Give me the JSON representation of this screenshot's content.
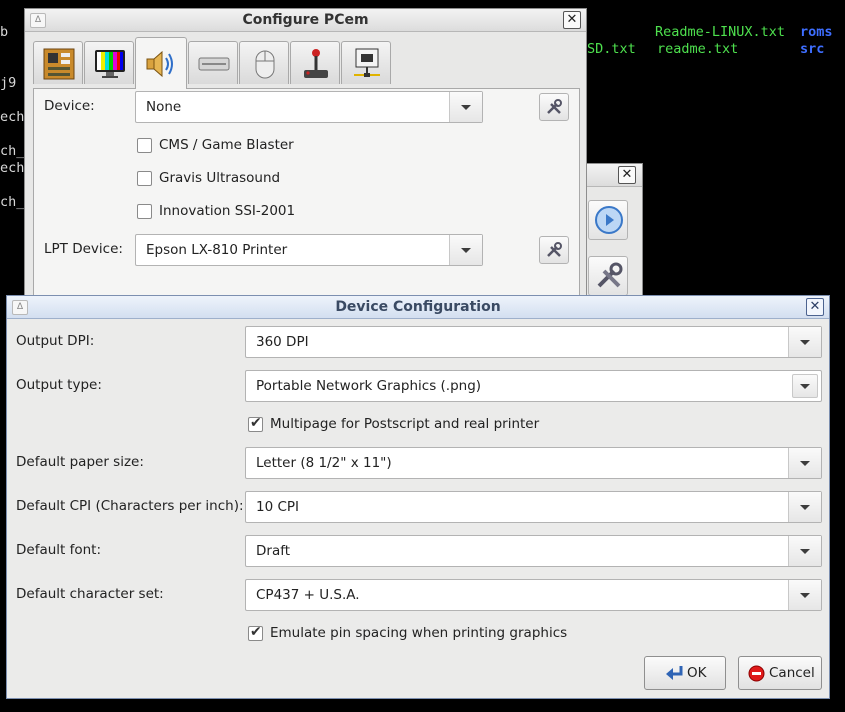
{
  "terminal": {
    "line1_green_left": "SD.txt",
    "readme_linux": "Readme-LINUX.txt",
    "readme_txt": "readme.txt",
    "roms": "roms",
    "src": "src",
    "b": "b",
    "j9": "j9",
    "ech1": "ech",
    "ch": "ch_",
    "ech2": "ech",
    "ch2": "ch_"
  },
  "configure_window": {
    "title": "Configure PCem",
    "tabs": [
      "motherboard-icon",
      "display-icon",
      "sound-icon",
      "drive-icon",
      "mouse-icon",
      "joystick-icon",
      "network-icon"
    ],
    "device_label": "Device:",
    "device_value": "None",
    "checkboxes": [
      {
        "label": "CMS / Game Blaster",
        "checked": false
      },
      {
        "label": "Gravis Ultrasound",
        "checked": false
      },
      {
        "label": "Innovation SSI-2001",
        "checked": false
      }
    ],
    "lpt_label": "LPT Device:",
    "lpt_value": "Epson LX-810 Printer"
  },
  "device_config": {
    "title": "Device Configuration",
    "fields": [
      {
        "label": "Output DPI:",
        "value": "360 DPI"
      },
      {
        "label": "Output type:",
        "value": "Portable Network Graphics (.png)"
      },
      {
        "label": "Default paper size:",
        "value": "Letter (8 1/2\" x 11\")"
      },
      {
        "label": "Default CPI (Characters per inch):",
        "value": "10 CPI"
      },
      {
        "label": "Default font:",
        "value": "Draft"
      },
      {
        "label": "Default character set:",
        "value": "CP437 + U.S.A."
      }
    ],
    "multipage_label": "Multipage for Postscript and real printer",
    "multipage_checked": true,
    "emulate_label": "Emulate pin spacing when printing graphics",
    "emulate_checked": true,
    "ok_label": "OK",
    "cancel_label": "Cancel",
    "check_glyph": "✔"
  },
  "titlebar_glyphs": {
    "menu": "∆",
    "close": "✕"
  },
  "colors": {
    "titlebar_active": "#d3dff0",
    "terminal_green": "#4ee04e",
    "terminal_blue": "#3e6eff"
  }
}
